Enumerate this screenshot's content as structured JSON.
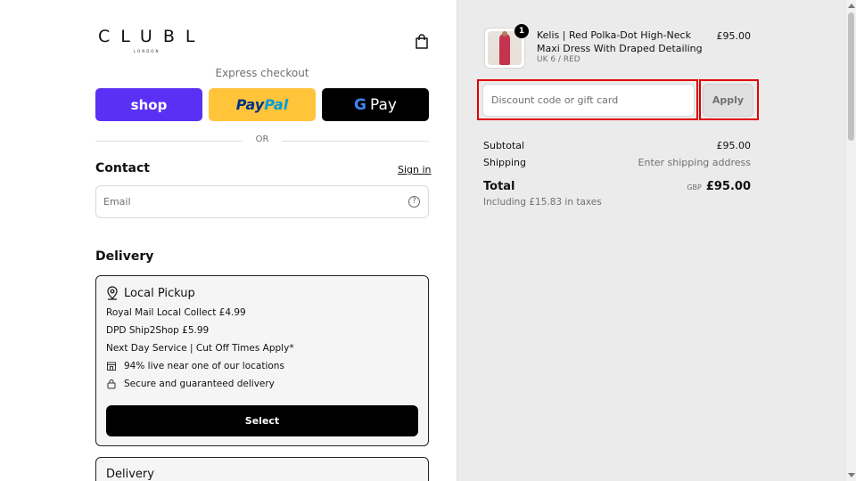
{
  "brand": {
    "name": "CLUBL",
    "subtitle": "LONDON"
  },
  "express": {
    "label": "Express checkout",
    "shop_label": "shop",
    "paypal_part1": "Pay",
    "paypal_part2": "Pal",
    "gpay_g": "G",
    "gpay_label": "Pay"
  },
  "divider_text": "OR",
  "contact": {
    "title": "Contact",
    "signin_label": "Sign in",
    "email_placeholder": "Email"
  },
  "delivery": {
    "title": "Delivery",
    "pickup": {
      "title": "Local Pickup",
      "line1": "Royal Mail Local Collect £4.99",
      "line2": "DPD Ship2Shop £5.99",
      "line3": "Next Day Service | Cut Off Times Apply*",
      "line4": "94% live near one of our locations",
      "line5": "Secure and guaranteed delivery",
      "select_label": "Select"
    },
    "delivery_option_title": "Delivery"
  },
  "order": {
    "product_name": "Kelis | Red Polka-Dot High-Neck Maxi Dress With Draped Detailing",
    "variant": "UK 6 / RED",
    "price": "£95.00",
    "quantity": "1",
    "discount_placeholder": "Discount code or gift card",
    "apply_label": "Apply",
    "subtotal_label": "Subtotal",
    "subtotal_value": "£95.00",
    "shipping_label": "Shipping",
    "shipping_value": "Enter shipping address",
    "total_label": "Total",
    "currency": "GBP",
    "total_value": "£95.00",
    "tax_note": "Including £15.83 in taxes"
  },
  "colors": {
    "shop_purple": "#5a31f4",
    "paypal_yellow": "#ffc439",
    "highlight_red": "#e00000",
    "sidebar_bg": "#ebebeb"
  }
}
